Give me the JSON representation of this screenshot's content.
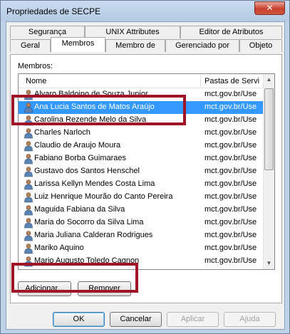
{
  "window": {
    "title": "Propriedades de SECPE",
    "close_glyph": "✕"
  },
  "tabs_back": [
    "Segurança",
    "UNIX Attributes",
    "Editor de Atributos"
  ],
  "tabs_front": [
    "Geral",
    "Membros",
    "Membro de",
    "Gerenciado por",
    "Objeto"
  ],
  "active_tab": "Membros",
  "members": {
    "label": "Membros:",
    "columns": {
      "name": "Nome",
      "folder": "Pastas de Servi"
    },
    "rows": [
      {
        "name": "Alvaro Baldoino de Souza Junior",
        "folder": "mct.gov.br/Use"
      },
      {
        "name": "Ana Lucia Santos de Matos Araújo",
        "folder": "mct.gov.br/Use",
        "selected": true
      },
      {
        "name": "Carolina Rezende Melo da Silva",
        "folder": "mct.gov.br/Use"
      },
      {
        "name": "Charles Narloch",
        "folder": "mct.gov.br/Use"
      },
      {
        "name": "Claudio de Araujo Moura",
        "folder": "mct.gov.br/Use"
      },
      {
        "name": "Fabiano Borba Guimaraes",
        "folder": "mct.gov.br/Use"
      },
      {
        "name": "Gustavo dos Santos Henschel",
        "folder": "mct.gov.br/Use"
      },
      {
        "name": "Larissa Kellyn Mendes Costa Lima",
        "folder": "mct.gov.br/Use"
      },
      {
        "name": "Luiz Henrique Mourão do Canto Pereira",
        "folder": "mct.gov.br/Use"
      },
      {
        "name": "Maguida Fabiana da Silva",
        "folder": "mct.gov.br/Use"
      },
      {
        "name": "Maria do Socorro da Silva Lima",
        "folder": "mct.gov.br/Use"
      },
      {
        "name": "Maria Juliana Calderan Rodrigues",
        "folder": "mct.gov.br/Use"
      },
      {
        "name": "Mariko Aquino",
        "folder": "mct.gov.br/Use"
      },
      {
        "name": "Mario Augusto Toledo Cagnon",
        "folder": "mct.gov.br/Use"
      }
    ]
  },
  "buttons": {
    "add": "Adicionar...",
    "remove": "Remover",
    "ok": "OK",
    "cancel": "Cancelar",
    "apply": "Aplicar",
    "help": "Ajuda"
  },
  "colors": {
    "selection": "#3399ff",
    "highlight_box": "#a01427"
  },
  "icons": {
    "member": "user-icon"
  }
}
